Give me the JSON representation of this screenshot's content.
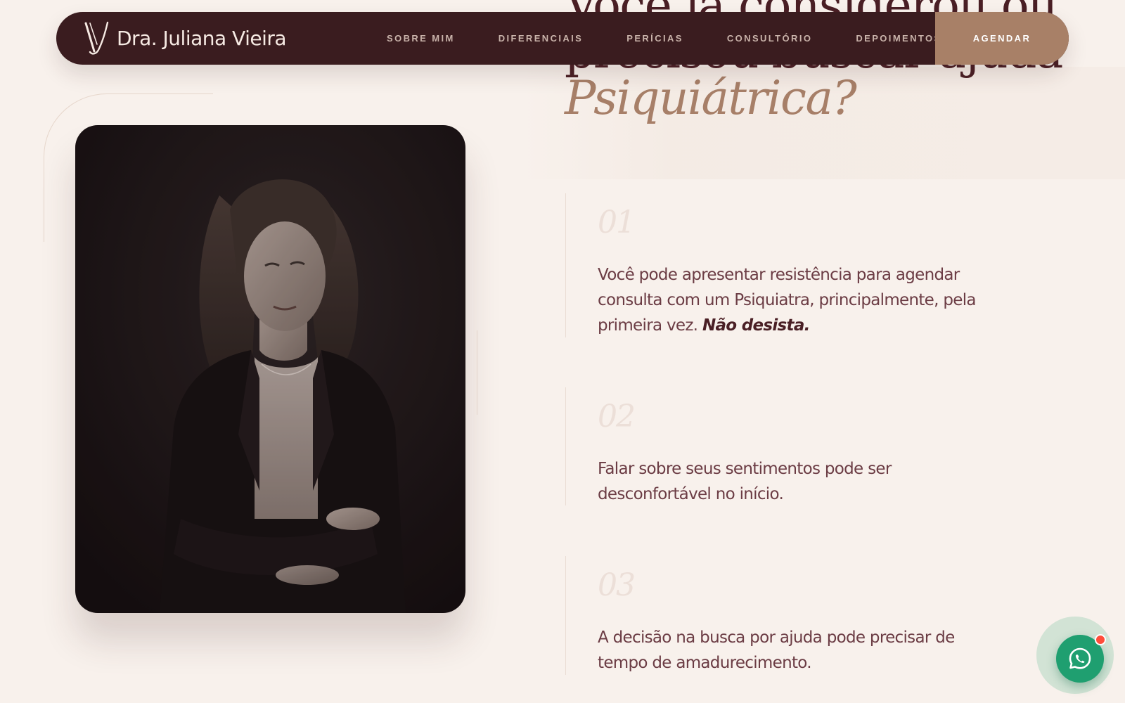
{
  "brand": {
    "name": "Dra. Juliana Vieira",
    "logo_icon": "jv-monogram-icon"
  },
  "nav": {
    "links": [
      "SOBRE MIM",
      "DIFERENCIAIS",
      "PERÍCIAS",
      "CONSULTÓRIO",
      "DEPOIMENTOS"
    ],
    "cta": "AGENDAR"
  },
  "hero": {
    "title_line1": "Você já considerou ou",
    "title_line2": "precisou buscar ajuda",
    "title_accent": "Psiquiátrica?"
  },
  "items": [
    {
      "number": "01",
      "text": "Você pode apresentar resistência para agendar consulta com um Psiquiatra, principalmente, pela primeira vez.",
      "emphasis": "Não desista."
    },
    {
      "number": "02",
      "text": "Falar sobre seus sentimentos pode ser desconfortável no início."
    },
    {
      "number": "03",
      "text": "A decisão na busca por ajuda pode precisar de tempo de amadurecimento."
    }
  ],
  "whatsapp": {
    "icon": "whatsapp-icon",
    "has_notification": true
  },
  "colors": {
    "background": "#f8f1ec",
    "navbar": "#3a1c1f",
    "accent": "#a88067",
    "heading": "#4a1f25",
    "body_text": "#6b3c44",
    "whatsapp": "#1f9f70",
    "notification": "#ff4d3a"
  }
}
